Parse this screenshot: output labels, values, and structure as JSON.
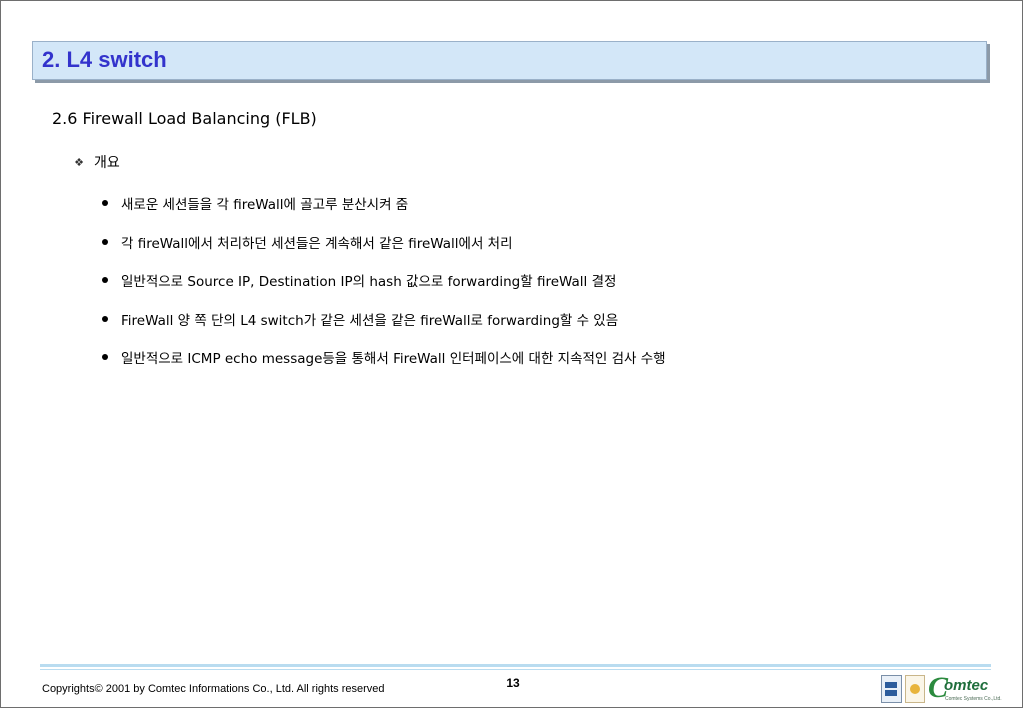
{
  "slide": {
    "title": "2. L4 switch",
    "section_heading": "2.6 Firewall  Load Balancing (FLB)",
    "overview_label": "개요",
    "bullets": [
      "새로운 세션들을 각 fireWall에 골고루 분산시켜 줌",
      "각 fireWall에서 처리하던 세션들은 계속해서 같은 fireWall에서 처리",
      "일반적으로 Source IP, Destination IP의 hash 값으로 forwarding할 fireWall 결정",
      "FireWall 양 쪽 단의 L4 switch가 같은 세션을 같은 fireWall로 forwarding할 수 있음",
      "일반적으로 ICMP echo message등을 통해서 FireWall 인터페이스에 대한 지속적인 검사 수행"
    ]
  },
  "footer": {
    "copyright": "Copyrights© 2001 by Comtec Informations Co., Ltd. All rights reserved",
    "page_number": "13",
    "logo_text": "omtec",
    "logo_initial": "C",
    "logo_subtitle": "Comtec Systems Co.,Ltd."
  },
  "colors": {
    "title_text": "#3333cc",
    "title_bar_bg": "#d3e7f8",
    "footer_line": "#b9dcf0",
    "logo_green": "#1f6e3c"
  },
  "icons": {
    "overview_bullet": "diamond-icon",
    "list_bullet": "bullet-dot"
  }
}
